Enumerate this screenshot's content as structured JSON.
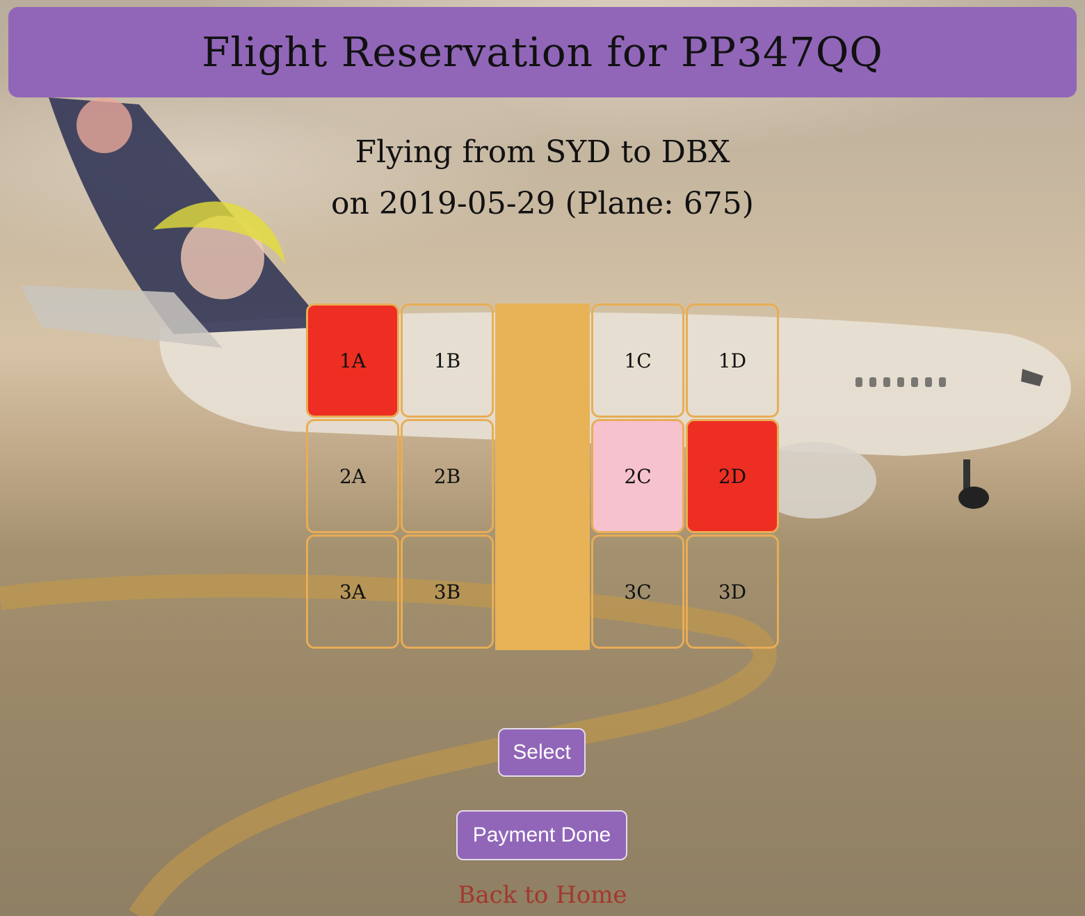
{
  "header": {
    "title": "Flight Reservation for PP347QQ"
  },
  "flight": {
    "route_line": "Flying from SYD to DBX",
    "date_line": "on 2019-05-29 (Plane: 675)"
  },
  "seats": {
    "1A": {
      "label": "1A",
      "status": "taken"
    },
    "1B": {
      "label": "1B",
      "status": "available"
    },
    "1C": {
      "label": "1C",
      "status": "available"
    },
    "1D": {
      "label": "1D",
      "status": "available"
    },
    "2A": {
      "label": "2A",
      "status": "available"
    },
    "2B": {
      "label": "2B",
      "status": "available"
    },
    "2C": {
      "label": "2C",
      "status": "selected"
    },
    "2D": {
      "label": "2D",
      "status": "taken"
    },
    "3A": {
      "label": "3A",
      "status": "available"
    },
    "3B": {
      "label": "3B",
      "status": "available"
    },
    "3C": {
      "label": "3C",
      "status": "available"
    },
    "3D": {
      "label": "3D",
      "status": "available"
    }
  },
  "actions": {
    "select_label": "Select",
    "payment_label": "Payment Done",
    "back_label": "Back to Home"
  },
  "colors": {
    "header": "#9166b8",
    "seat_border": "#e8ad55",
    "aisle": "#e8b257",
    "taken": "#ee2e22",
    "selected": "#f5c2cd",
    "link": "#a2382e"
  }
}
